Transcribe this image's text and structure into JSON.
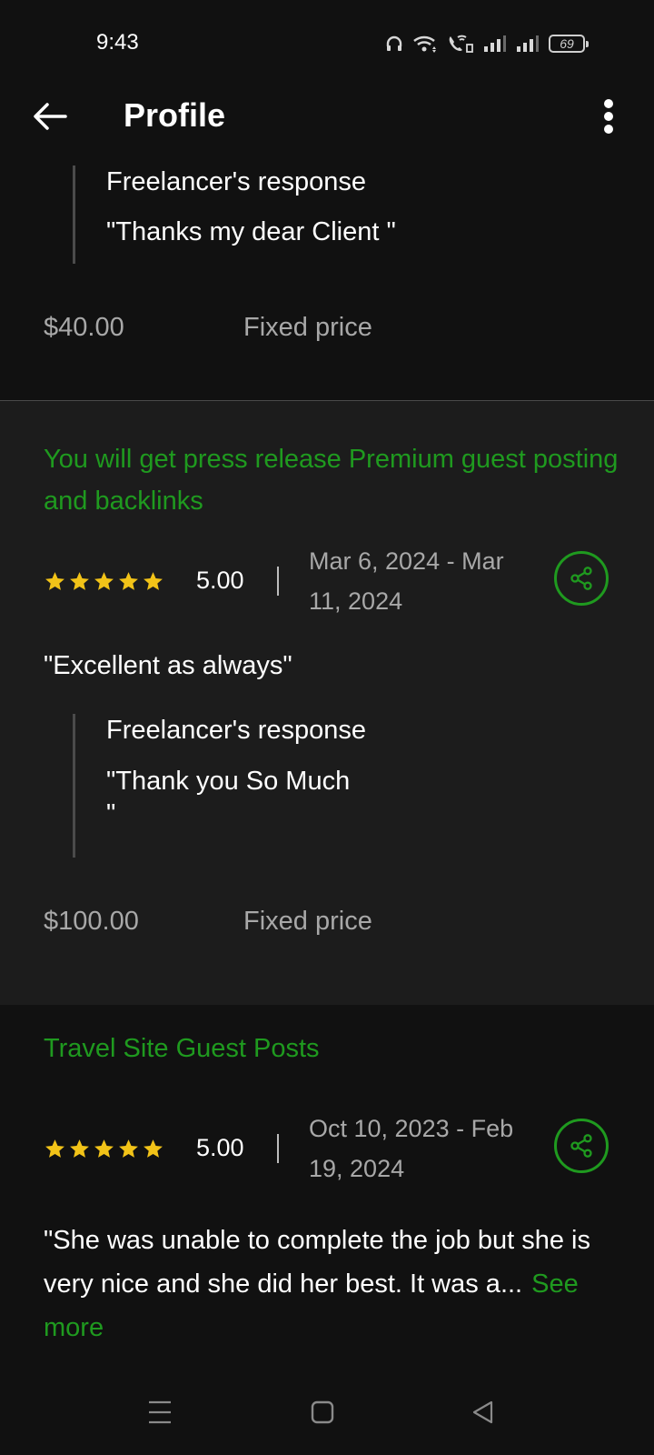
{
  "status_bar": {
    "time": "9:43",
    "battery": "69",
    "icons": [
      "headphones-icon",
      "wifi-icon",
      "wifi-call-icon",
      "signal-icon",
      "signal-icon",
      "battery-icon"
    ]
  },
  "app_bar": {
    "title": "Profile",
    "back_icon": "back-arrow-icon",
    "menu_icon": "more-vert-icon"
  },
  "reviews": [
    {
      "response_heading": "Freelancer's response",
      "response_text": "\"Thanks my dear Client \"",
      "price": "$40.00",
      "price_type": "Fixed price"
    },
    {
      "title": "You will get press release Premium guest posting and backlinks",
      "rating": "5.00",
      "stars": 5,
      "date_range": "Mar 6, 2024 - Mar 11, 2024",
      "review": "\"Excellent as always\"",
      "response_heading": "Freelancer's response",
      "response_text": "\"Thank you So Much\n\"",
      "price": "$100.00",
      "price_type": "Fixed price"
    },
    {
      "title": "Travel Site Guest Posts",
      "rating": "5.00",
      "stars": 5,
      "date_range": "Oct 10, 2023 - Feb 19, 2024",
      "review": "\"She was unable to complete the job but she is very nice and she did her best. It was a...",
      "see_more": "See more"
    }
  ],
  "colors": {
    "accent": "#1f9a1f",
    "star": "#f2c318",
    "background": "#111111",
    "card_background": "#1c1c1c",
    "muted_text": "#a8a8a8"
  },
  "nav_bar": {
    "icons": [
      "menu-icon",
      "home-icon",
      "back-icon"
    ]
  }
}
